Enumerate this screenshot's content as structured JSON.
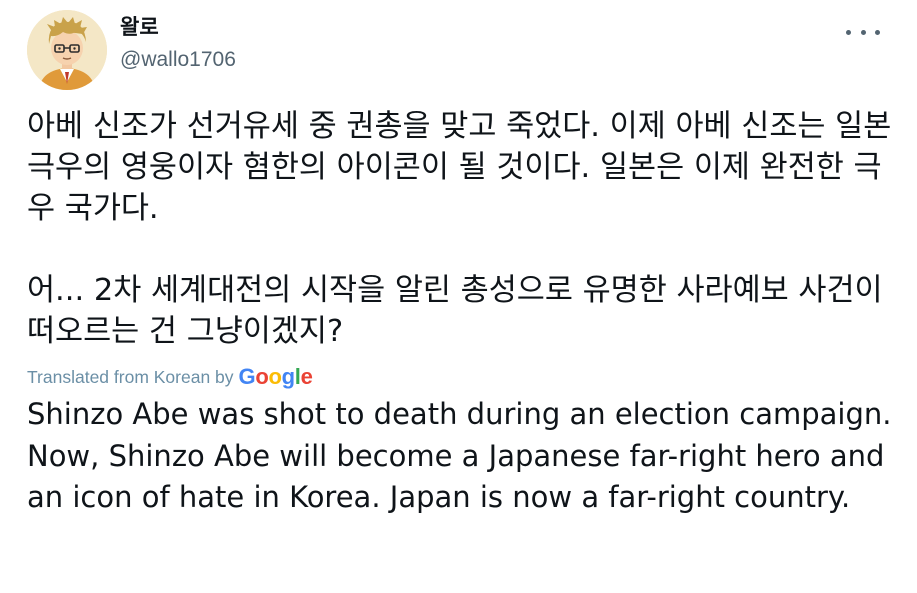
{
  "user": {
    "display_name": "왈로",
    "handle": "@wallo1706",
    "avatar_icon": "cartoon-avatar"
  },
  "menu": {
    "more_icon": "more-horizontal-icon"
  },
  "tweet": {
    "paragraphs": [
      "아베 신조가 선거유세 중 권총을 맞고 죽었다. 이제 아베 신조는 일본 극우의 영웅이자 혐한의 아이콘이 될 것이다. 일본은 이제 완전한 극우 국가다.",
      "어... 2차 세계대전의 시작을 알린 총성으로 유명한 사라예보 사건이 떠오르는 건 그냥이겠지?"
    ]
  },
  "translation": {
    "label": "Translated from Korean by",
    "provider": "Google",
    "provider_colors": [
      "#4285F4",
      "#EA4335",
      "#FBBC05",
      "#4285F4",
      "#34A853",
      "#EA4335"
    ],
    "text": "Shinzo Abe was shot to death during an election campaign. Now, Shinzo Abe will become a Japanese far-right hero and an icon of hate in Korea. Japan is now a far-right country."
  },
  "colors": {
    "primary_text": "#0f1419",
    "secondary_text": "#536471",
    "translated_label": "#6b8fa6"
  }
}
